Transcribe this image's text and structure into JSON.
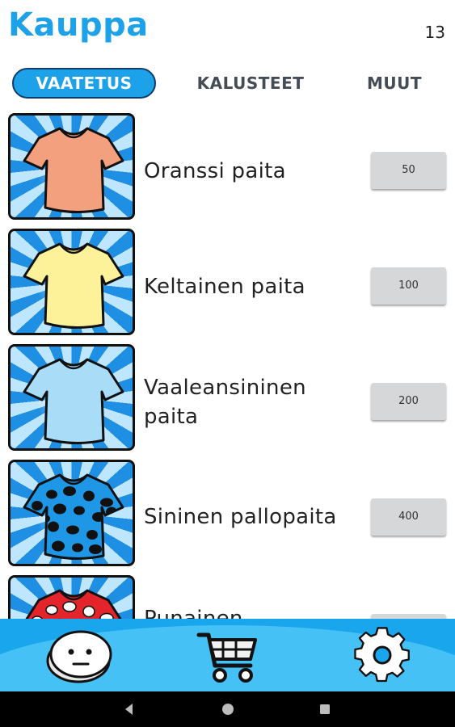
{
  "header": {
    "title": "Kauppa",
    "coins": "13"
  },
  "tabs": [
    {
      "label": "VAATETUS",
      "active": true
    },
    {
      "label": "KALUSTEET",
      "active": false
    },
    {
      "label": "MUUT",
      "active": false
    }
  ],
  "items": [
    {
      "name": "Oranssi paita",
      "price": "50",
      "shirt_color": "#f3a07e",
      "pattern": "plain"
    },
    {
      "name": "Keltainen paita",
      "price": "100",
      "shirt_color": "#fdf29a",
      "pattern": "plain"
    },
    {
      "name": "Vaaleansininen paita",
      "price": "200",
      "shirt_color": "#a9dcf7",
      "pattern": "plain"
    },
    {
      "name": "Sininen pallopaita",
      "price": "400",
      "shirt_color": "#1e97e6",
      "pattern": "polka-dots"
    },
    {
      "name": "Punainen",
      "price": "",
      "shirt_color": "#e3242b",
      "pattern": "white-dots"
    }
  ],
  "bottom_nav": [
    {
      "icon": "face-icon",
      "label": "profile"
    },
    {
      "icon": "shopping-cart-icon",
      "label": "shop"
    },
    {
      "icon": "gear-icon",
      "label": "settings"
    }
  ],
  "colors": {
    "accent": "#1da1e8",
    "bar": "#1aa6ec"
  }
}
